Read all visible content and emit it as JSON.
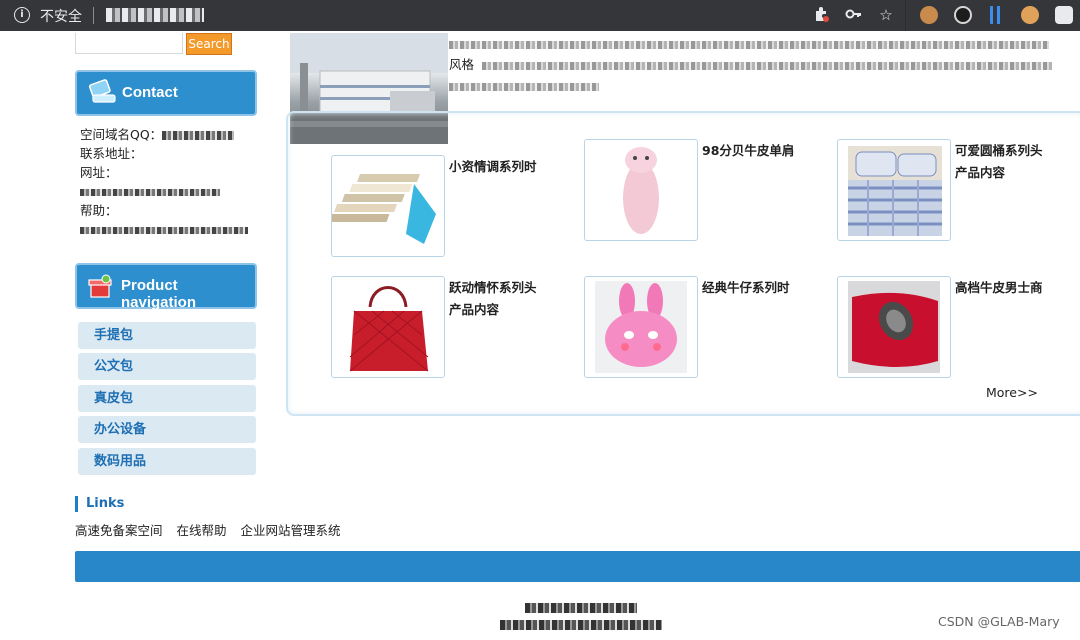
{
  "browser": {
    "security_label": "不安全",
    "info_icon_glyph": "i",
    "toolbar_icons": [
      "puzzle-icon",
      "key-icon",
      "star-icon"
    ],
    "extension_icons": [
      "cookie-icon",
      "mask-icon",
      "bars-icon",
      "cookie-icon",
      "chat-icon"
    ]
  },
  "search": {
    "button_label": "Search",
    "value": ""
  },
  "contact": {
    "header": "Contact",
    "lines": [
      "空间域名QQ：",
      "联系地址：",
      "网址：",
      "帮助："
    ]
  },
  "product_nav": {
    "header": "Product navigation",
    "items": [
      "手提包",
      "公文包",
      "真皮包",
      "办公设备",
      "数码用品"
    ]
  },
  "intro": {
    "row1_parts": [
      "… 页 … 动画 … 导航 … 代 … 自定义URL … 多"
    ],
    "row2_label": "风格",
    "row2_text": "每种语言每个页面 … html静态页面 … 人性化后台操作， … 快速",
    "row3_text": "建站 … 维护 …"
  },
  "products": [
    {
      "title": "小资情调系列时",
      "sub": ""
    },
    {
      "title": "98分贝牛皮单肩",
      "sub": ""
    },
    {
      "title": "可爱圆桶系列头",
      "sub": "产品内容"
    },
    {
      "title": "跃动情怀系列头",
      "sub": "产品内容"
    },
    {
      "title": "经典牛仔系列时",
      "sub": ""
    },
    {
      "title": "高档牛皮男士商",
      "sub": ""
    }
  ],
  "more_label": "More>>",
  "links": {
    "header": "Links",
    "items": [
      "高速免备案空间",
      "在线帮助",
      "企业网站管理系统"
    ]
  },
  "watermark": "CSDN @GLAB-Mary",
  "colors": {
    "accent_blue": "#2e8fcf",
    "search_orange": "#f49a2b",
    "nav_bg": "#dbe9f2",
    "footer_blue": "#2787c9"
  }
}
